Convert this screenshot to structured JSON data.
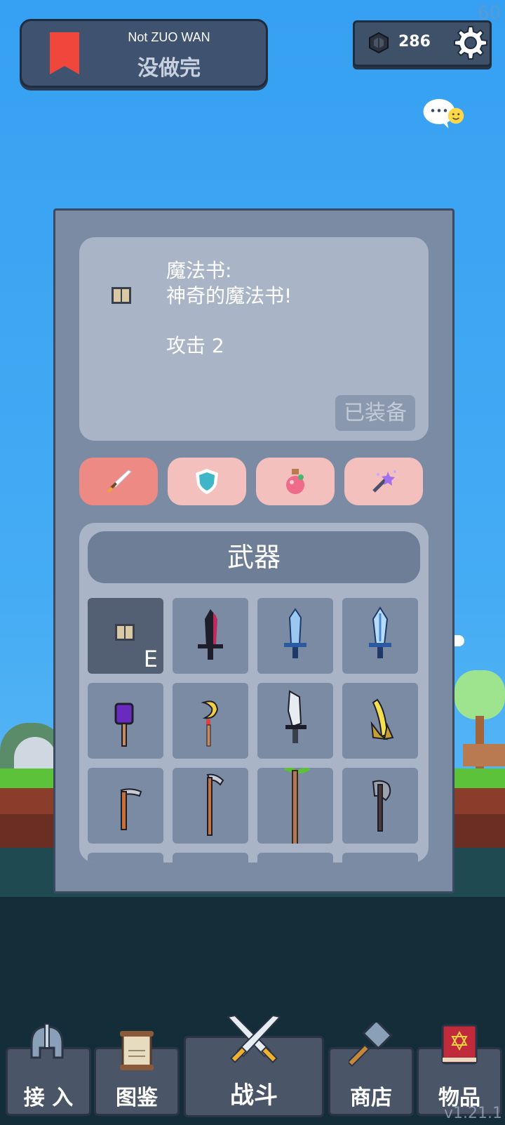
{
  "status": {
    "fps": "60",
    "version": "v1.21.1"
  },
  "level": {
    "subtitle": "Not ZUO WAN",
    "title": "没做完"
  },
  "currency": {
    "amount": "286",
    "icon": "gem-icon"
  },
  "item_info": {
    "name": "魔法书:",
    "description": "神奇的魔法书!",
    "stat": "攻击 2",
    "equip_label": "已装备"
  },
  "tabs": [
    {
      "name": "weapon",
      "icon": "sword-icon",
      "active": true
    },
    {
      "name": "armor",
      "icon": "shield-icon",
      "active": false
    },
    {
      "name": "potion",
      "icon": "potion-icon",
      "active": false
    },
    {
      "name": "magic",
      "icon": "magic-wand-icon",
      "active": false
    }
  ],
  "inventory": {
    "header": "武器",
    "slots": [
      {
        "item": "magic-book-icon",
        "badge": "E",
        "selected": true
      },
      {
        "item": "dark-blade-icon",
        "badge": ""
      },
      {
        "item": "ice-sword-icon",
        "badge": ""
      },
      {
        "item": "crystal-sword-icon",
        "badge": ""
      },
      {
        "item": "purple-staff-icon",
        "badge": ""
      },
      {
        "item": "moon-staff-icon",
        "badge": ""
      },
      {
        "item": "cleaver-icon",
        "badge": ""
      },
      {
        "item": "banana-icon",
        "badge": ""
      },
      {
        "item": "sickle-icon",
        "badge": ""
      },
      {
        "item": "scythe-icon",
        "badge": ""
      },
      {
        "item": "sprout-spear-icon",
        "badge": ""
      },
      {
        "item": "axe-icon",
        "badge": ""
      }
    ]
  },
  "nav": {
    "join": "接 入",
    "codex": "图鉴",
    "battle": "战斗",
    "shop": "商店",
    "items": "物品"
  }
}
